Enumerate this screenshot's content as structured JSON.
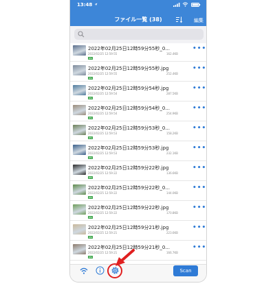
{
  "status_bar": {
    "time": "13:48"
  },
  "header": {
    "title": "ファイル一覧 (38)",
    "edit_label": "編集"
  },
  "search": {
    "placeholder": ""
  },
  "rows": [
    {
      "name": "2022年02月25日12時59分55秒_0...",
      "date": "2022/02/25 12:59:55",
      "size": "162.4KB",
      "badge": "JPG",
      "thumb": "#5a6e8c"
    },
    {
      "name": "2022年02月25日12時59分55秒.jpg",
      "date": "2022/02/25 12:59:55",
      "size": "252.4KB",
      "badge": "JPG",
      "thumb": "#7d8a9b"
    },
    {
      "name": "2022年02月25日12時59分54秒.jpg",
      "date": "2022/02/25 12:59:54",
      "size": "287.5KB",
      "badge": "JPG",
      "thumb": "#4f7b9e"
    },
    {
      "name": "2022年02月25日12時59分54秒_0...",
      "date": "2022/02/25 12:59:54",
      "size": "254.9KB",
      "badge": "JPG",
      "thumb": "#9a8b7a"
    },
    {
      "name": "2022年02月25日12時59分53秒_0...",
      "date": "2022/02/25 12:59:53",
      "size": "158.2KB",
      "badge": "JPG",
      "thumb": "#6b7f57"
    },
    {
      "name": "2022年02月25日12時59分53秒.jpg",
      "date": "2022/02/25 12:59:53",
      "size": "232.1KB",
      "badge": "JPG",
      "thumb": "#3a5f8a"
    },
    {
      "name": "2022年02月25日12時59分22秒.jpg",
      "date": "2022/02/25 12:59:22",
      "size": "136.6KB",
      "badge": "JPG",
      "thumb": "#2b2b2b"
    },
    {
      "name": "2022年02月25日12時59分22秒_0...",
      "date": "2022/02/25 12:59:22",
      "size": "144.0KB",
      "badge": "JPG",
      "thumb": "#5d8a4a"
    },
    {
      "name": "2022年02月25日12時59分22秒.jpg",
      "date": "2022/02/25 12:59:22",
      "size": "170.8KB",
      "badge": "JPG",
      "thumb": "#6e9d5a"
    },
    {
      "name": "2022年02月25日12時59分21秒.jpg",
      "date": "2022/02/25 12:59:21",
      "size": "223.6KB",
      "badge": "JPG",
      "thumb": "#c9b89a"
    },
    {
      "name": "2022年02月25日12時59分21秒_0...",
      "date": "2022/02/25 12:59:21",
      "size": "166.7KB",
      "badge": "JPG",
      "thumb": "#8c7a6b"
    },
    {
      "name": "2022年02月25日12時59分21秒_0...",
      "date": "",
      "size": "",
      "badge": "",
      "thumb": "#7a8c9e"
    }
  ],
  "toolbar": {
    "scan_label": "Scan"
  },
  "icons": {
    "status": [
      "location-arrow-icon",
      "signal-bars-icon",
      "wifi-icon",
      "battery-icon"
    ],
    "header": [
      "sort-icon"
    ],
    "search": [
      "search-icon"
    ],
    "row": [
      "more-icon"
    ],
    "toolbar": [
      "wifi-icon",
      "info-icon",
      "settings-gear-icon"
    ],
    "annotation": [
      "red-arrow-icon"
    ]
  },
  "colors": {
    "header_bg": "#3d86d8",
    "accent": "#2f7bd6",
    "badge_green": "#3aa548",
    "highlight_red": "#e02020"
  }
}
